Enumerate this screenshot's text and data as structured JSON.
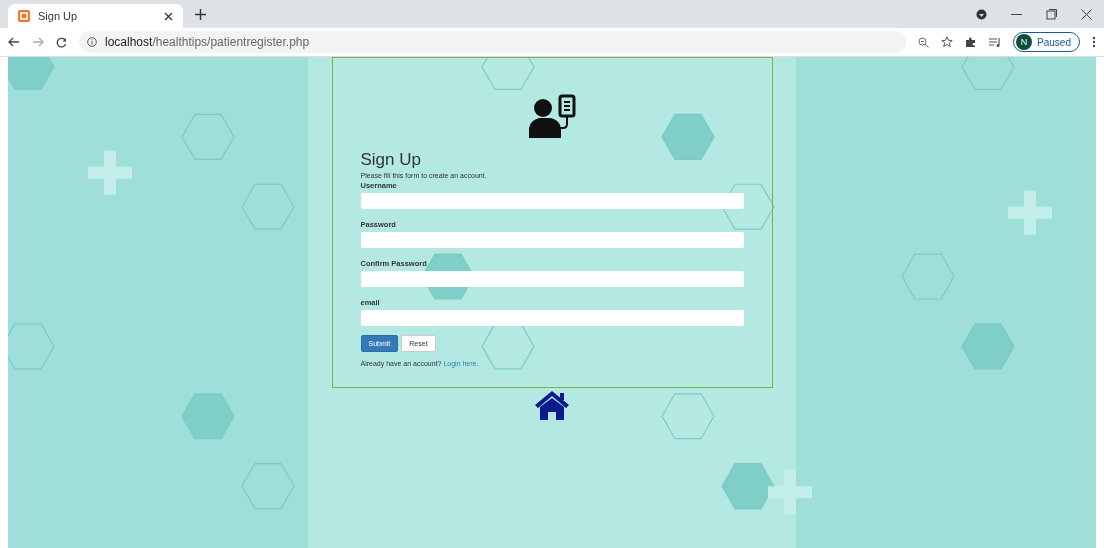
{
  "browser": {
    "tab": {
      "title": "Sign Up",
      "selected": true
    },
    "url": {
      "host": "localhost",
      "path": "/healthtips/patientregister.php"
    },
    "profile": {
      "initial": "N",
      "status": "Paused"
    }
  },
  "page": {
    "form": {
      "title": "Sign Up",
      "subtitle": "Please fill this form to create an account.",
      "fields": [
        {
          "label": "Username"
        },
        {
          "label": "Password"
        },
        {
          "label": "Confirm Password"
        },
        {
          "label": "email"
        }
      ],
      "buttons": [
        {
          "label": "Submit",
          "kind": "primary"
        },
        {
          "label": "Reset",
          "kind": "default"
        }
      ],
      "footer": {
        "text": "Already have an account?",
        "link": "Login here."
      }
    }
  }
}
